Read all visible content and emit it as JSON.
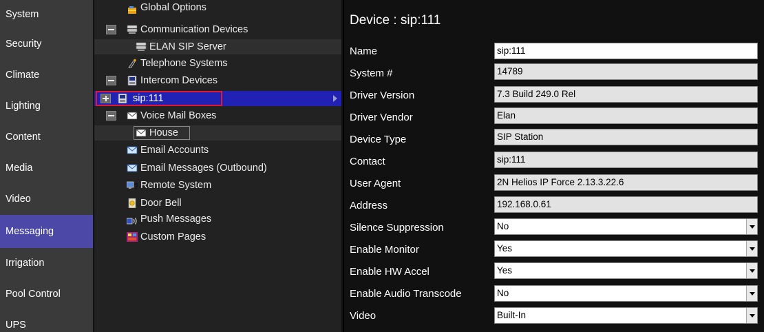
{
  "nav": {
    "items": [
      {
        "label": "System"
      },
      {
        "label": "Security"
      },
      {
        "label": "Climate"
      },
      {
        "label": "Lighting"
      },
      {
        "label": "Content"
      },
      {
        "label": "Media"
      },
      {
        "label": "Video"
      },
      {
        "label": "Messaging",
        "active": true
      },
      {
        "label": "Irrigation"
      },
      {
        "label": "Pool Control"
      },
      {
        "label": "UPS"
      }
    ]
  },
  "tree": {
    "global_options": "Global Options",
    "communication_devices": "Communication Devices",
    "elan_sip_server": "ELAN SIP Server",
    "telephone_systems": "Telephone Systems",
    "intercom_devices": "Intercom Devices",
    "sip_device": "sip:111",
    "voice_mail_boxes": "Voice Mail Boxes",
    "house": "House",
    "email_accounts": "Email Accounts",
    "email_messages": "Email Messages (Outbound)",
    "remote_system": "Remote System",
    "door_bell": "Door Bell",
    "push_messages": "Push Messages",
    "custom_pages": "Custom Pages"
  },
  "detail": {
    "title": "Device : sip:111",
    "fields": {
      "name": {
        "label": "Name",
        "value": "sip:111"
      },
      "system_no": {
        "label": "System #",
        "value": "14789"
      },
      "driver_version": {
        "label": "Driver Version",
        "value": "7.3 Build 249.0 Rel"
      },
      "driver_vendor": {
        "label": "Driver Vendor",
        "value": "Elan"
      },
      "device_type": {
        "label": "Device Type",
        "value": "SIP Station"
      },
      "contact": {
        "label": "Contact",
        "value": "sip:111"
      },
      "user_agent": {
        "label": "User Agent",
        "value": "2N Helios IP Force 2.13.3.22.6"
      },
      "address": {
        "label": "Address",
        "value": "192.168.0.61"
      },
      "silence_suppression": {
        "label": "Silence Suppression",
        "value": "No"
      },
      "enable_monitor": {
        "label": "Enable Monitor",
        "value": "Yes"
      },
      "enable_hw_accel": {
        "label": "Enable HW Accel",
        "value": "Yes"
      },
      "enable_audio_transcode": {
        "label": "Enable Audio Transcode",
        "value": "No"
      },
      "video": {
        "label": "Video",
        "value": "Built-In"
      }
    }
  },
  "colors": {
    "nav_active": "#4b48a8",
    "tree_selected": "#2121b4",
    "selection_outline": "#e01838"
  }
}
